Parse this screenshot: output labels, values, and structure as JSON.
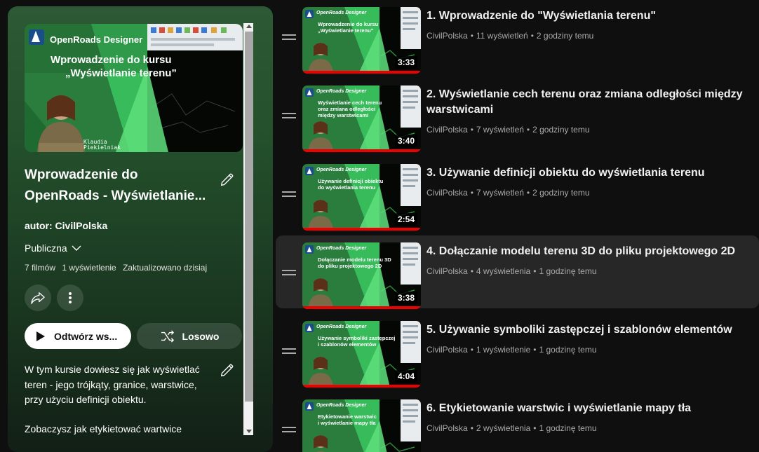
{
  "playlist": {
    "title": "Wprowadzenie do OpenRoads - Wyświetlanie...",
    "author": "autor: CivilPolska",
    "privacy": "Publiczna",
    "videos_count": "7 filmów",
    "views": "1 wyświetlenie",
    "updated": "Zaktualizowano dzisiaj",
    "play_label": "Odtwórz ws...",
    "shuffle_label": "Losowo",
    "description_1": "W tym kursie dowiesz się jak wyświetlać teren - jego trójkąty, granice, warstwice, przy użyciu definicji obiektu.",
    "description_2": "Zobaczysz jak etykietować wartwice"
  },
  "hero": {
    "brand": "OpenRoads Designer",
    "line1": "Wprowadzenie do kursu",
    "line2": "„Wyświetlanie terenu”",
    "presenter1": "Klaudia",
    "presenter2": "Piekielniak"
  },
  "thumbs": [
    {
      "brand": "OpenRoads Designer",
      "t1": "Wprowadzenie do kursu",
      "t2": "„Wyświetlanie terenu”",
      "t3": ""
    },
    {
      "brand": "OpenRoads Designer",
      "t1": "Wyświetlanie cech terenu",
      "t2": "oraz zmiana odległości",
      "t3": "między warstwicami"
    },
    {
      "brand": "OpenRoads Designer",
      "t1": "Używanie definicji obiektu",
      "t2": "do wyświetlania terenu",
      "t3": ""
    },
    {
      "brand": "OpenRoads Designer",
      "t1": "Dołączanie modelu terenu 3D",
      "t2": "do pliku projektowego 2D",
      "t3": ""
    },
    {
      "brand": "OpenRoads Designer",
      "t1": "Używanie symboliki zastępczej",
      "t2": "i szablonów elementów",
      "t3": ""
    },
    {
      "brand": "OpenRoads Designer",
      "t1": "Etykietowanie warstwic",
      "t2": "i wyświetlanie mapy tła",
      "t3": ""
    }
  ],
  "videos": [
    {
      "title": "1. Wprowadzenie do \"Wyświetlania terenu\"",
      "channel": "CivilPolska",
      "views": "11 wyświetleń",
      "age": "2 godziny temu",
      "duration": "3:33",
      "selected": false
    },
    {
      "title": "2. Wyświetlanie cech terenu oraz zmiana odległości między warstwicami",
      "channel": "CivilPolska",
      "views": "7 wyświetleń",
      "age": "2 godziny temu",
      "duration": "3:40",
      "selected": false
    },
    {
      "title": "3. Używanie definicji obiektu do wyświetlania terenu",
      "channel": "CivilPolska",
      "views": "7 wyświetleń",
      "age": "2 godziny temu",
      "duration": "2:54",
      "selected": false
    },
    {
      "title": "4. Dołączanie modelu terenu 3D do pliku projektowego 2D",
      "channel": "CivilPolska",
      "views": "4 wyświetlenia",
      "age": "1 godzinę temu",
      "duration": "3:38",
      "selected": true
    },
    {
      "title": "5. Używanie symboliki zastępczej i szablonów elementów",
      "channel": "CivilPolska",
      "views": "1 wyświetlenie",
      "age": "1 godzinę temu",
      "duration": "4:04",
      "selected": false
    },
    {
      "title": "6. Etykietowanie warstwic i wyświetlanie mapy tła",
      "channel": "CivilPolska",
      "views": "2 wyświetlenia",
      "age": "1 godzinę temu",
      "duration": "",
      "selected": false
    }
  ],
  "icons": {
    "edit": "pencil-icon",
    "share": "share-icon",
    "more": "more-vert-icon",
    "play": "play-icon",
    "shuffle": "shuffle-icon",
    "drag": "drag-handle-icon",
    "chevron": "chevron-down-icon"
  },
  "colors": {
    "background": "#0f0f0f",
    "selected_row": "#272727",
    "progress": "#ee0000",
    "thumb_green": "#2fa84f"
  }
}
